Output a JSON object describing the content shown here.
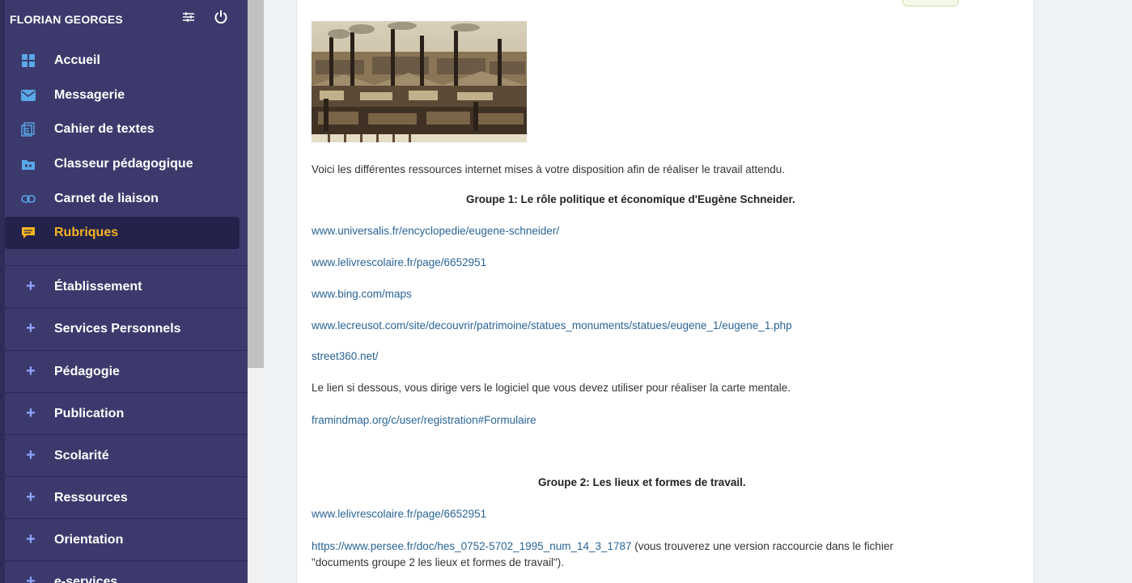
{
  "user": {
    "name": "FLORIAN GEORGES"
  },
  "nav": [
    {
      "label": "Accueil"
    },
    {
      "label": "Messagerie"
    },
    {
      "label": "Cahier de textes"
    },
    {
      "label": "Classeur pédagogique"
    },
    {
      "label": "Carnet de liaison"
    },
    {
      "label": "Rubriques"
    }
  ],
  "sections": [
    {
      "label": "Établissement"
    },
    {
      "label": "Services Personnels"
    },
    {
      "label": "Pédagogie"
    },
    {
      "label": "Publication"
    },
    {
      "label": "Scolarité"
    },
    {
      "label": "Ressources"
    },
    {
      "label": "Orientation"
    },
    {
      "label": "e-services"
    }
  ],
  "content": {
    "intro": "Voici les différentes ressources internet mises à votre disposition afin de réaliser le travail attendu.",
    "group1_title": "Groupe 1: Le rôle politique et économique d'Eugène Schneider.",
    "group1_links": [
      "www.universalis.fr/encyclopedie/eugene-schneider/",
      "www.lelivrescolaire.fr/page/6652951",
      "www.bing.com/maps",
      "www.lecreusot.com/site/decouvrir/patrimoine/statues_monuments/statues/eugene_1/eugene_1.php",
      "street360.net/"
    ],
    "mindmap_text": "Le lien si dessous, vous dirige vers le logiciel que vous devez utiliser pour réaliser la carte mentale.",
    "mindmap_link": "framindmap.org/c/user/registration#Formulaire",
    "group2_title": "Groupe 2: Les lieux et formes de travail.",
    "group2_link1": "www.lelivrescolaire.fr/page/6652951",
    "group2_link2": "https://www.persee.fr/doc/hes_0752-5702_1995_num_14_3_1787",
    "group2_note1": " (vous trouverez une version raccourcie dans le fichier",
    "group2_note2": "\"documents groupe 2 les lieux et formes de travail\")."
  },
  "colors": {
    "sidebar": "#3c3a6c",
    "active_accent": "#f4b323",
    "link": "#2a6496",
    "plus": "#8fa4ff"
  }
}
